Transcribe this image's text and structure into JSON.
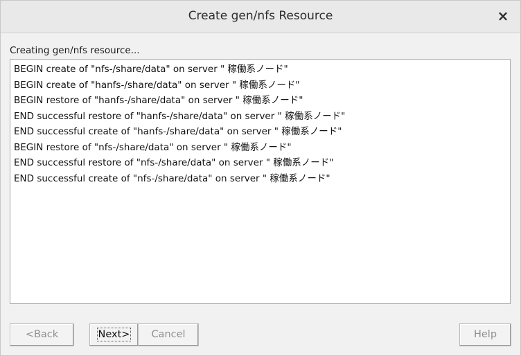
{
  "window": {
    "title": "Create gen/nfs Resource",
    "close_label": "×"
  },
  "status_label": "Creating gen/nfs resource...",
  "log_lines": [
    "BEGIN create of \"nfs-/share/data\" on server \" 稼働系ノード\"",
    "BEGIN create of \"hanfs-/share/data\" on server \" 稼働系ノード\"",
    "BEGIN restore of \"hanfs-/share/data\" on server \" 稼働系ノード\"",
    "END successful restore of \"hanfs-/share/data\" on server \" 稼働系ノード\"",
    "END successful create of \"hanfs-/share/data\" on server \" 稼働系ノード\"",
    "BEGIN restore of \"nfs-/share/data\" on server \" 稼働系ノード\"",
    "END successful restore of \"nfs-/share/data\" on server \" 稼働系ノード\"",
    "END successful create of \"nfs-/share/data\" on server \" 稼働系ノード\""
  ],
  "buttons": {
    "back_label": "<Back",
    "next_label": "Next>",
    "cancel_label": "Cancel",
    "help_label": "Help"
  }
}
